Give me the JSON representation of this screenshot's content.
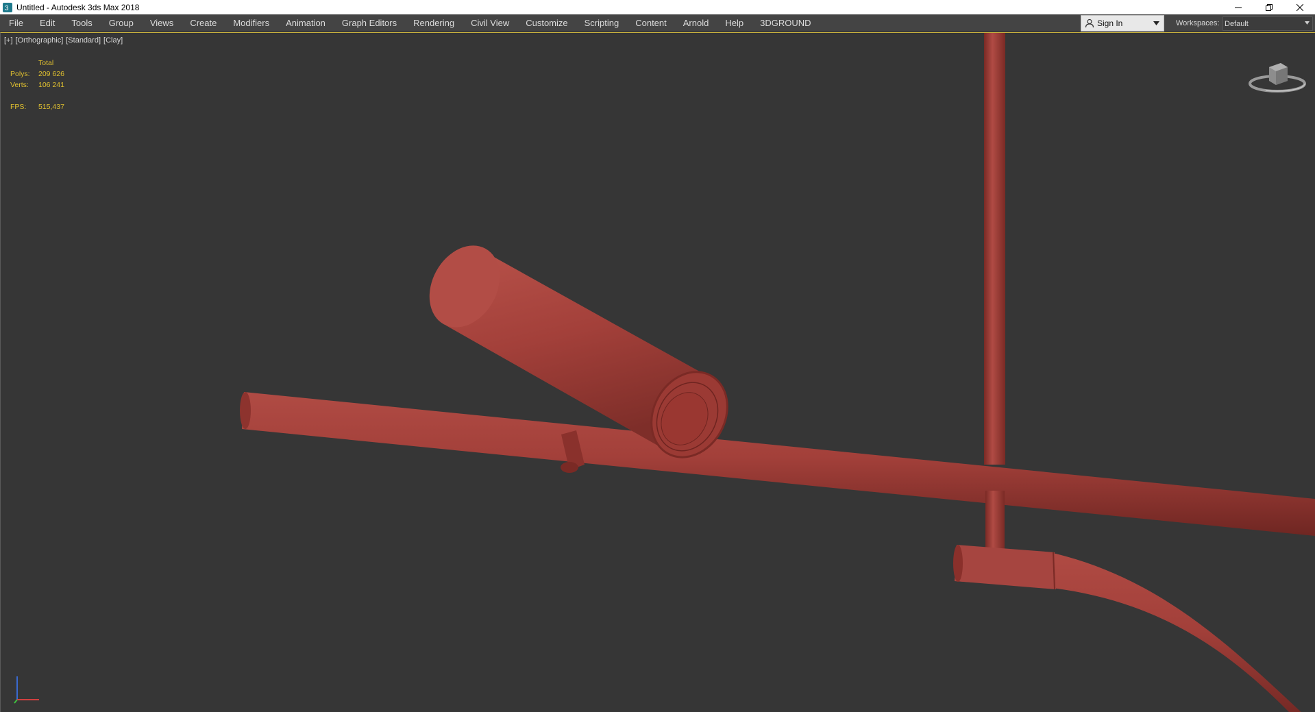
{
  "window": {
    "title": "Untitled - Autodesk 3ds Max 2018",
    "controls": [
      "minimize",
      "restore",
      "close"
    ]
  },
  "menu": {
    "items": [
      "File",
      "Edit",
      "Tools",
      "Group",
      "Views",
      "Create",
      "Modifiers",
      "Animation",
      "Graph Editors",
      "Rendering",
      "Civil View",
      "Customize",
      "Scripting",
      "Content",
      "Arnold",
      "Help",
      "3DGROUND"
    ],
    "signin_label": "Sign In",
    "workspaces_label": "Workspaces:",
    "workspace_value": "Default"
  },
  "viewport": {
    "labels": [
      "[+]",
      "[Orthographic]",
      "[Standard]",
      "[Clay]"
    ],
    "stats": {
      "header": "Total",
      "polys_label": "Polys:",
      "polys_value": "209 626",
      "verts_label": "Verts:",
      "verts_value": "106 241",
      "fps_label": "FPS:",
      "fps_value": "515,437"
    },
    "viewcube_icon": "viewcube-icon",
    "axis_icon": "axis-tripod-icon"
  },
  "colors": {
    "model": "#a3403a",
    "viewport_bg": "#363636",
    "stats_text": "#e0c030",
    "active_border": "#c9b23d"
  }
}
